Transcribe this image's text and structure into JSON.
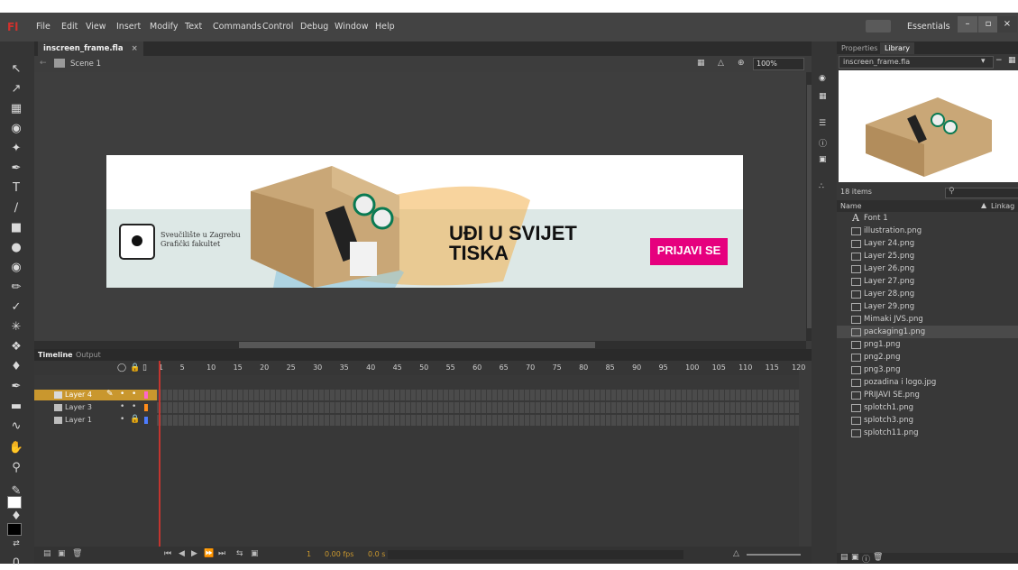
{
  "app": {
    "logo": "Fl",
    "menu": [
      "File",
      "Edit",
      "View",
      "Insert",
      "Modify",
      "Text",
      "Commands",
      "Control",
      "Debug",
      "Window",
      "Help"
    ],
    "workspace": "Essentials",
    "window_buttons": [
      "–",
      "▫",
      "×"
    ]
  },
  "document": {
    "tab_label": "inscreen_frame.fla",
    "tab_close": "×",
    "scene": "Scene 1",
    "zoom": "100%"
  },
  "banner": {
    "university_line1": "Sveučilište u Zagrebu",
    "university_line2": "Grafički fakultet",
    "headline_line1": "UĐI U SVIJET",
    "headline_line2": "TISKA",
    "cta": "PRIJAVI SE"
  },
  "timeline": {
    "tabs": [
      "Timeline",
      "Output"
    ],
    "frame_numbers": [
      "1",
      "5",
      "10",
      "15",
      "20",
      "25",
      "30",
      "35",
      "40",
      "45",
      "50",
      "55",
      "60",
      "65",
      "70",
      "75",
      "80",
      "85",
      "90",
      "95",
      "100",
      "105",
      "110",
      "115",
      "120"
    ],
    "layers": [
      {
        "name": "Layer 4",
        "color": "#ff66cc",
        "selected": true
      },
      {
        "name": "Layer 3",
        "color": "#ff8c1a",
        "selected": false
      },
      {
        "name": "Layer 1",
        "color": "#4d7cff",
        "selected": false
      }
    ],
    "current_frame": "1",
    "fps": "0.00 fps",
    "time": "0.0 s"
  },
  "panel": {
    "tabs": [
      "Properties",
      "Library"
    ],
    "active_tab": "Library",
    "library_doc": "inscreen_frame.fla",
    "item_count": "18 items",
    "col_name": "Name",
    "col_linkage": "Linkag",
    "items": [
      {
        "name": "Font 1",
        "type": "font"
      },
      {
        "name": "illustration.png",
        "type": "bitmap"
      },
      {
        "name": "Layer 24.png",
        "type": "bitmap"
      },
      {
        "name": "Layer 25.png",
        "type": "bitmap"
      },
      {
        "name": "Layer 26.png",
        "type": "bitmap"
      },
      {
        "name": "Layer 27.png",
        "type": "bitmap"
      },
      {
        "name": "Layer 28.png",
        "type": "bitmap"
      },
      {
        "name": "Layer 29.png",
        "type": "bitmap"
      },
      {
        "name": "Mimaki JVS.png",
        "type": "bitmap"
      },
      {
        "name": "packaging1.png",
        "type": "bitmap",
        "selected": true
      },
      {
        "name": "png1.png",
        "type": "bitmap"
      },
      {
        "name": "png2.png",
        "type": "bitmap"
      },
      {
        "name": "png3.png",
        "type": "bitmap"
      },
      {
        "name": "pozadina i logo.jpg",
        "type": "bitmap"
      },
      {
        "name": "PRIJAVI SE.png",
        "type": "bitmap"
      },
      {
        "name": "splotch1.png",
        "type": "bitmap"
      },
      {
        "name": "splotch3.png",
        "type": "bitmap"
      },
      {
        "name": "splotch11.png",
        "type": "bitmap"
      }
    ]
  },
  "colors": {
    "accent_orange": "#c9972e",
    "logo_red": "#d2312c",
    "cta_magenta": "#e6007e",
    "playhead": "#c3352f"
  }
}
